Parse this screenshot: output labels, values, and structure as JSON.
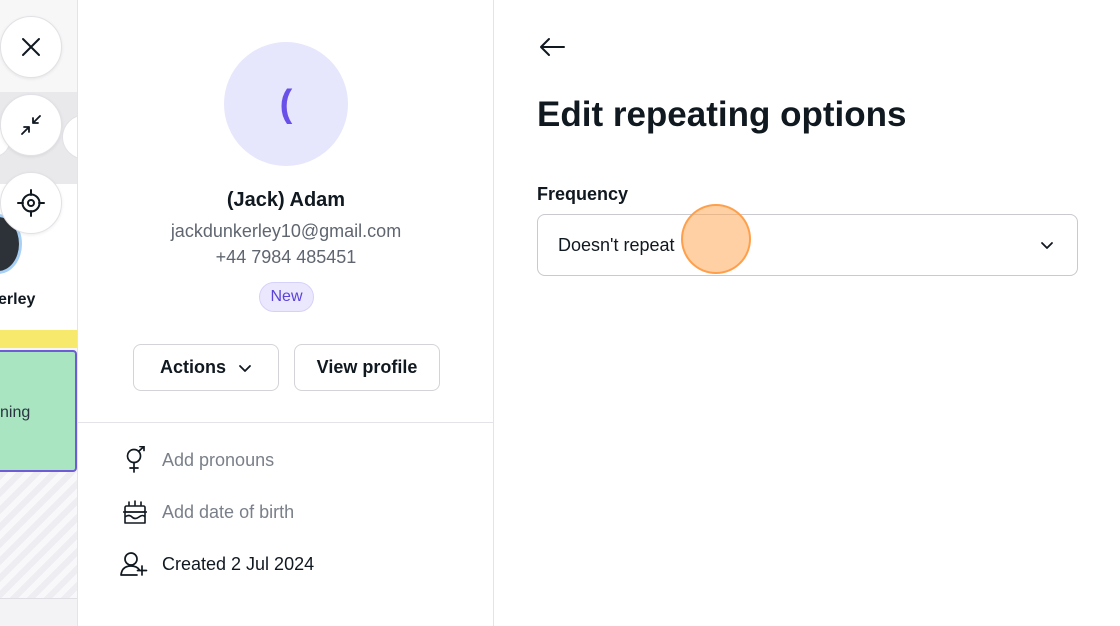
{
  "calendar_strip": {
    "staff_name": "erley",
    "appointment_text": "ning"
  },
  "overlay_buttons": {
    "close": "close-icon",
    "minimize": "minimize-icon",
    "locate": "crosshair-icon"
  },
  "client": {
    "avatar_initial": "(",
    "name": "(Jack) Adam",
    "email": "jackdunkerley10@gmail.com",
    "phone": "+44 7984 485451",
    "badge": "New",
    "actions_label": "Actions",
    "view_profile_label": "View profile",
    "details": [
      {
        "icon": "gender-icon",
        "label": "Add pronouns"
      },
      {
        "icon": "cake-icon",
        "label": "Add date of birth"
      },
      {
        "icon": "user-add-icon",
        "label": "Created 2 Jul 2024"
      }
    ]
  },
  "edit": {
    "title": "Edit repeating options",
    "frequency_label": "Frequency",
    "frequency_value": "Doesn't repeat"
  },
  "colors": {
    "accent": "#6950e8",
    "avatar_bg": "#e6e6fc",
    "badge_bg": "#ebe8fd",
    "appointment_bg": "#a8e5c0",
    "click_marker": "#ffaa5a"
  }
}
